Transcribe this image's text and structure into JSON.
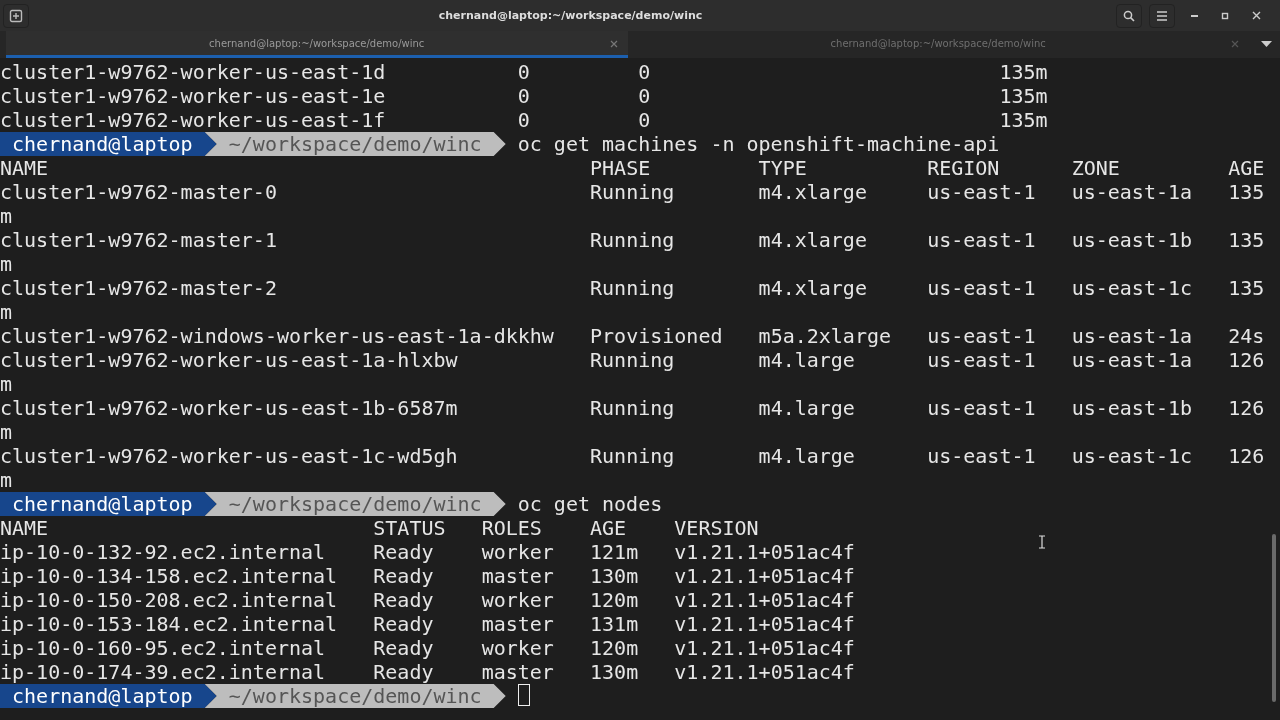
{
  "window": {
    "title": "chernand@laptop:~/workspace/demo/winc"
  },
  "tabs": [
    {
      "label": "chernand@laptop:~/workspace/demo/winc",
      "selected": true
    },
    {
      "label": "chernand@laptop:~/workspace/demo/winc",
      "selected": false
    }
  ],
  "lines": [
    {
      "kind": "text",
      "text": "cluster1-w9762-worker-us-east-1d           0         0                             135m"
    },
    {
      "kind": "text",
      "text": "cluster1-w9762-worker-us-east-1e           0         0                             135m"
    },
    {
      "kind": "text",
      "text": "cluster1-w9762-worker-us-east-1f           0         0                             135m"
    },
    {
      "kind": "prompt",
      "user": "chernand@laptop",
      "path": "~/workspace/demo/winc",
      "command": "oc get machines -n openshift-machine-api",
      "cursor": false
    },
    {
      "kind": "text",
      "text": "NAME                                             PHASE         TYPE          REGION      ZONE         AGE"
    },
    {
      "kind": "text",
      "text": "cluster1-w9762-master-0                          Running       m4.xlarge     us-east-1   us-east-1a   135"
    },
    {
      "kind": "text",
      "text": "m"
    },
    {
      "kind": "text",
      "text": "cluster1-w9762-master-1                          Running       m4.xlarge     us-east-1   us-east-1b   135"
    },
    {
      "kind": "text",
      "text": "m"
    },
    {
      "kind": "text",
      "text": "cluster1-w9762-master-2                          Running       m4.xlarge     us-east-1   us-east-1c   135"
    },
    {
      "kind": "text",
      "text": "m"
    },
    {
      "kind": "text",
      "text": "cluster1-w9762-windows-worker-us-east-1a-dkkhw   Provisioned   m5a.2xlarge   us-east-1   us-east-1a   24s"
    },
    {
      "kind": "text",
      "text": "cluster1-w9762-worker-us-east-1a-hlxbw           Running       m4.large      us-east-1   us-east-1a   126"
    },
    {
      "kind": "text",
      "text": "m"
    },
    {
      "kind": "text",
      "text": "cluster1-w9762-worker-us-east-1b-6587m           Running       m4.large      us-east-1   us-east-1b   126"
    },
    {
      "kind": "text",
      "text": "m"
    },
    {
      "kind": "text",
      "text": "cluster1-w9762-worker-us-east-1c-wd5gh           Running       m4.large      us-east-1   us-east-1c   126"
    },
    {
      "kind": "text",
      "text": "m"
    },
    {
      "kind": "prompt",
      "user": "chernand@laptop",
      "path": "~/workspace/demo/winc",
      "command": "oc get nodes",
      "cursor": false
    },
    {
      "kind": "text",
      "text": "NAME                           STATUS   ROLES    AGE    VERSION"
    },
    {
      "kind": "text",
      "text": "ip-10-0-132-92.ec2.internal    Ready    worker   121m   v1.21.1+051ac4f"
    },
    {
      "kind": "text",
      "text": "ip-10-0-134-158.ec2.internal   Ready    master   130m   v1.21.1+051ac4f"
    },
    {
      "kind": "text",
      "text": "ip-10-0-150-208.ec2.internal   Ready    worker   120m   v1.21.1+051ac4f"
    },
    {
      "kind": "text",
      "text": "ip-10-0-153-184.ec2.internal   Ready    master   131m   v1.21.1+051ac4f"
    },
    {
      "kind": "text",
      "text": "ip-10-0-160-95.ec2.internal    Ready    worker   120m   v1.21.1+051ac4f"
    },
    {
      "kind": "text",
      "text": "ip-10-0-174-39.ec2.internal    Ready    master   130m   v1.21.1+051ac4f"
    },
    {
      "kind": "prompt",
      "user": "chernand@laptop",
      "path": "~/workspace/demo/winc",
      "cursor": true
    }
  ]
}
